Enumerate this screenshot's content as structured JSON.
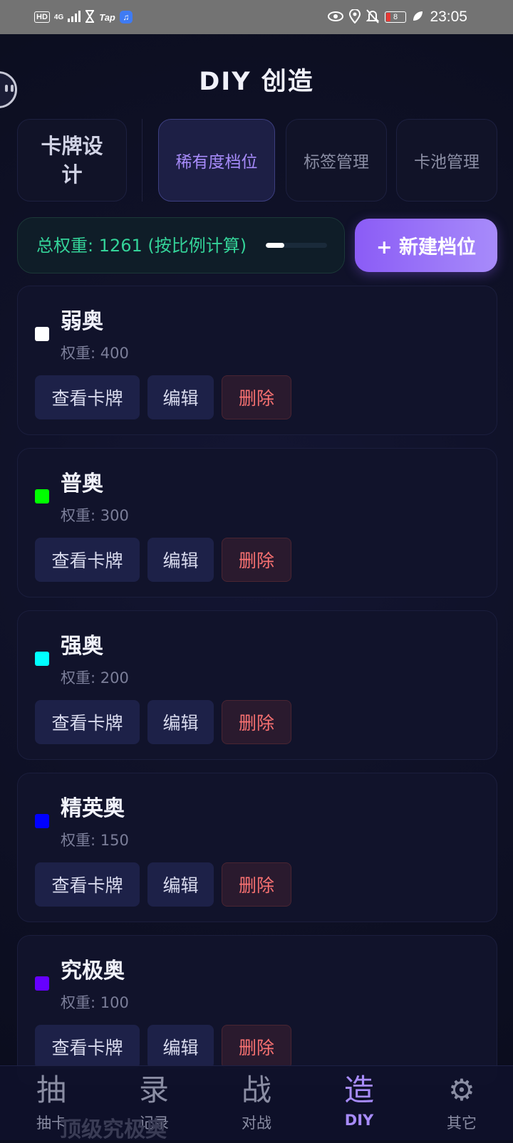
{
  "status_bar": {
    "hd": "HD",
    "network": "4G",
    "tap": "Tap",
    "battery": "8",
    "time": "23:05"
  },
  "header": {
    "title": "DIY 创造"
  },
  "tabs": {
    "design": "卡牌设计",
    "rarity": "稀有度档位",
    "labels": "标签管理",
    "pool": "卡池管理"
  },
  "weight": {
    "text": "总权重: 1261 (按比例计算)",
    "progress_fraction": 0.3
  },
  "new_tier_button": "+ 新建档位",
  "actions": {
    "view": "查看卡牌",
    "edit": "编辑",
    "delete": "删除"
  },
  "tiers": [
    {
      "name": "弱奥",
      "weight": "权重: 400",
      "color": "#ffffff"
    },
    {
      "name": "普奥",
      "weight": "权重: 300",
      "color": "#00ff00"
    },
    {
      "name": "强奥",
      "weight": "权重: 200",
      "color": "#00ffff"
    },
    {
      "name": "精英奥",
      "weight": "权重: 150",
      "color": "#0000ff"
    },
    {
      "name": "究极奥",
      "weight": "权重: 100",
      "color": "#6600ff"
    },
    {
      "name": "顶级究极奥",
      "weight": "",
      "color": "#ff00ff"
    }
  ],
  "nav": [
    {
      "glyph": "抽",
      "label": "抽卡",
      "icon": "draw-icon"
    },
    {
      "glyph": "录",
      "label": "记录",
      "icon": "record-icon"
    },
    {
      "glyph": "战",
      "label": "对战",
      "icon": "battle-icon"
    },
    {
      "glyph": "造",
      "label": "DIY",
      "icon": "create-icon"
    },
    {
      "glyph": "⚙",
      "label": "其它",
      "icon": "gear-icon"
    }
  ],
  "colors": {
    "accent": "#a78bfa",
    "weight_text": "#34d399",
    "delete_text": "#f87171",
    "background": "#0f1127"
  }
}
